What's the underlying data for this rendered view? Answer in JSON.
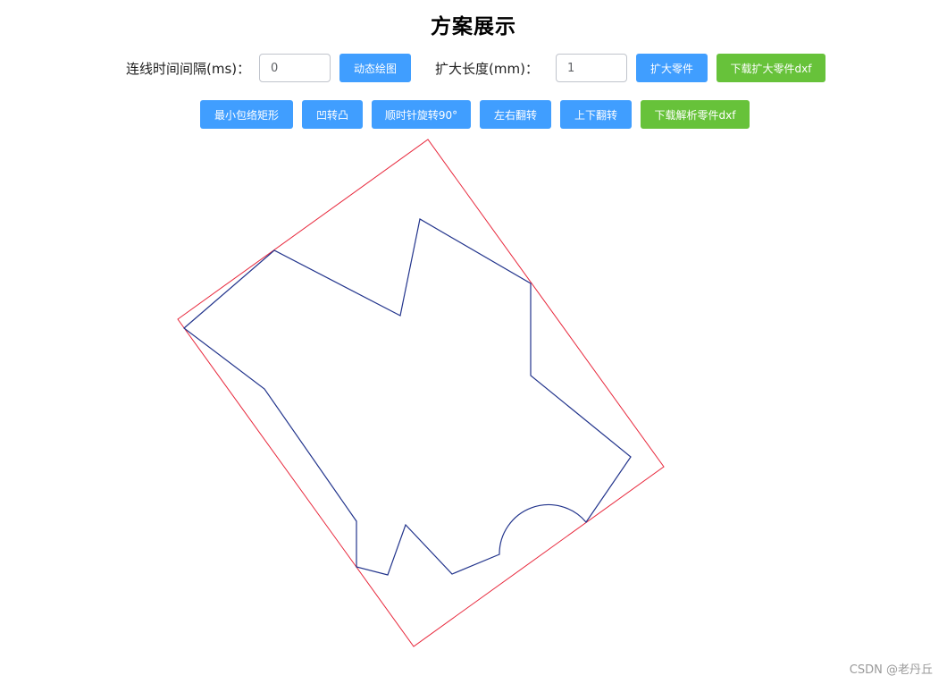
{
  "page": {
    "title": "方案展示"
  },
  "controls": {
    "interval_label": "连线时间间隔(ms)：",
    "interval_value": "0",
    "draw_button": "动态绘图",
    "expand_label": "扩大长度(mm)：",
    "expand_value": "1",
    "expand_button": "扩大零件",
    "download_expanded_button": "下载扩大零件dxf"
  },
  "actions": {
    "min_rect_button": "最小包络矩形",
    "concave_convex_button": "凹转凸",
    "rotate_button": "顺时针旋转90°",
    "flip_h_button": "左右翻转",
    "flip_v_button": "上下翻转",
    "download_parsed_button": "下载解析零件dxf"
  },
  "drawing": {
    "outline_color": "#22348c",
    "bounding_rect_color": "#e8283c"
  },
  "watermark": "CSDN @老丹丘"
}
